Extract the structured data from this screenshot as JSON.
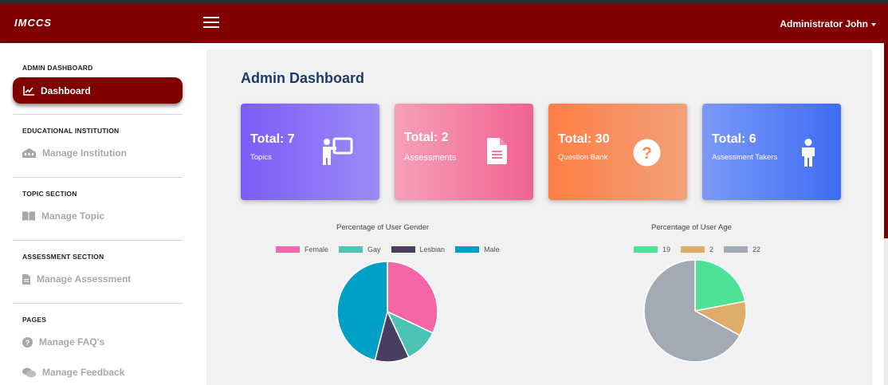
{
  "app": {
    "logo": "IMCCS",
    "user": "Administrator John"
  },
  "sidebar": {
    "sections": [
      {
        "title": "ADMIN DASHBOARD"
      },
      {
        "title": "EDUCATIONAL INSTITUTION"
      },
      {
        "title": "TOPIC SECTION"
      },
      {
        "title": "ASSESSMENT SECTION"
      },
      {
        "title": "PAGES"
      }
    ],
    "items": [
      {
        "label": "Dashboard",
        "icon": "line-chart-icon",
        "active": true
      },
      {
        "label": "Manage Institution",
        "icon": "building-icon"
      },
      {
        "label": "Manage Topic",
        "icon": "book-icon"
      },
      {
        "label": "Manage Assessment",
        "icon": "file-icon"
      },
      {
        "label": "Manage FAQ's",
        "icon": "question-circle-icon"
      },
      {
        "label": "Manage Feedback",
        "icon": "comments-icon"
      }
    ]
  },
  "main": {
    "title": "Admin Dashboard"
  },
  "cards": [
    {
      "total": "Total: 7",
      "label": "Topics",
      "icon": "teacher-board-icon",
      "color_from": "#7b5cf5",
      "color_to": "#9d8bf7"
    },
    {
      "total": "Total: 2",
      "label": "Assessments",
      "icon": "document-icon",
      "color_from": "#f6a0b8",
      "color_to": "#f06291"
    },
    {
      "total": "Total: 30",
      "label": "Question Bank",
      "icon": "question-circle-icon",
      "color_from": "#fe7f45",
      "color_to": "#f3a07a"
    },
    {
      "total": "Total: 6",
      "label": "Assessment Takers",
      "icon": "person-icon",
      "color_from": "#7b9af6",
      "color_to": "#3e6cf3"
    }
  ],
  "chart_data": [
    {
      "type": "pie",
      "title": "Percentage of User Gender",
      "categories": [
        "Female",
        "Gay",
        "Lesbian",
        "Male"
      ],
      "values": [
        32,
        11,
        11,
        46
      ],
      "colors": [
        "#f566a9",
        "#4cc3b5",
        "#4a3e5e",
        "#00a0c6"
      ],
      "legend": "top"
    },
    {
      "type": "pie",
      "title": "Percentage of User Age",
      "categories": [
        "19",
        "2",
        "22"
      ],
      "values": [
        22,
        11,
        67
      ],
      "colors": [
        "#4ee296",
        "#dfad6a",
        "#a4aab4"
      ],
      "legend": "top"
    }
  ]
}
